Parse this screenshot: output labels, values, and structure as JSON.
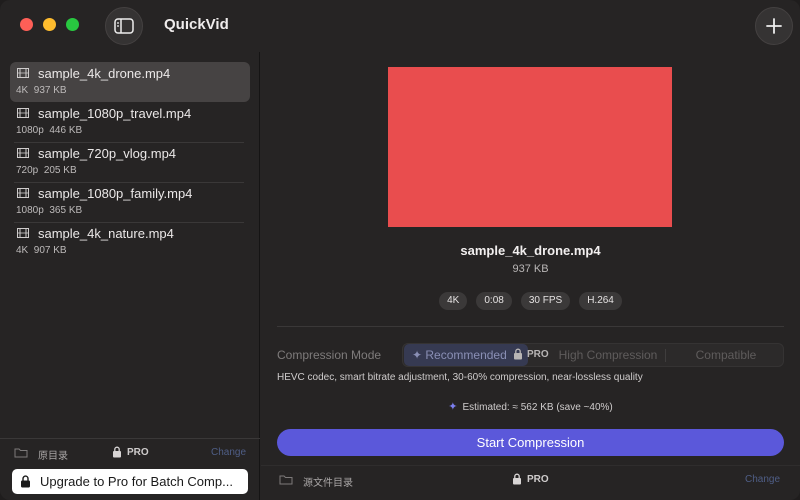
{
  "app": {
    "title": "QuickVid"
  },
  "colors": {
    "accent": "#5b58da",
    "preview": "#e94d4e",
    "selected_row": "#464343"
  },
  "sidebar": {
    "files": [
      {
        "name": "sample_4k_drone.mp4",
        "resolution": "4K",
        "size": "937 KB",
        "selected": true
      },
      {
        "name": "sample_1080p_travel.mp4",
        "resolution": "1080p",
        "size": "446 KB",
        "selected": false
      },
      {
        "name": "sample_720p_vlog.mp4",
        "resolution": "720p",
        "size": "205 KB",
        "selected": false
      },
      {
        "name": "sample_1080p_family.mp4",
        "resolution": "1080p",
        "size": "365 KB",
        "selected": false
      },
      {
        "name": "sample_4k_nature.mp4",
        "resolution": "4K",
        "size": "907 KB",
        "selected": false
      }
    ],
    "footer": {
      "folder_label": "原目录",
      "pro_label": "PRO",
      "change_label": "Change"
    },
    "upgrade_label": "Upgrade to Pro for Batch Comp..."
  },
  "main": {
    "file_name": "sample_4k_drone.mp4",
    "file_size": "937 KB",
    "tags": [
      "4K",
      "0:08",
      "30 FPS",
      "H.264"
    ],
    "compression": {
      "label": "Compression Mode",
      "options": {
        "recommended": "✦ Recommended",
        "high": "High Compression",
        "compatible": "Compatible"
      },
      "pro_label": "PRO",
      "selected": "recommended",
      "description": "HEVC codec, smart bitrate adjustment, 30-60% compression, near-lossless quality"
    },
    "estimated": "Estimated: ≈ 562 KB (save ~40%)",
    "start_label": "Start Compression",
    "footer": {
      "folder_label": "源文件目录",
      "pro_label": "PRO",
      "change_label": "Change"
    }
  }
}
